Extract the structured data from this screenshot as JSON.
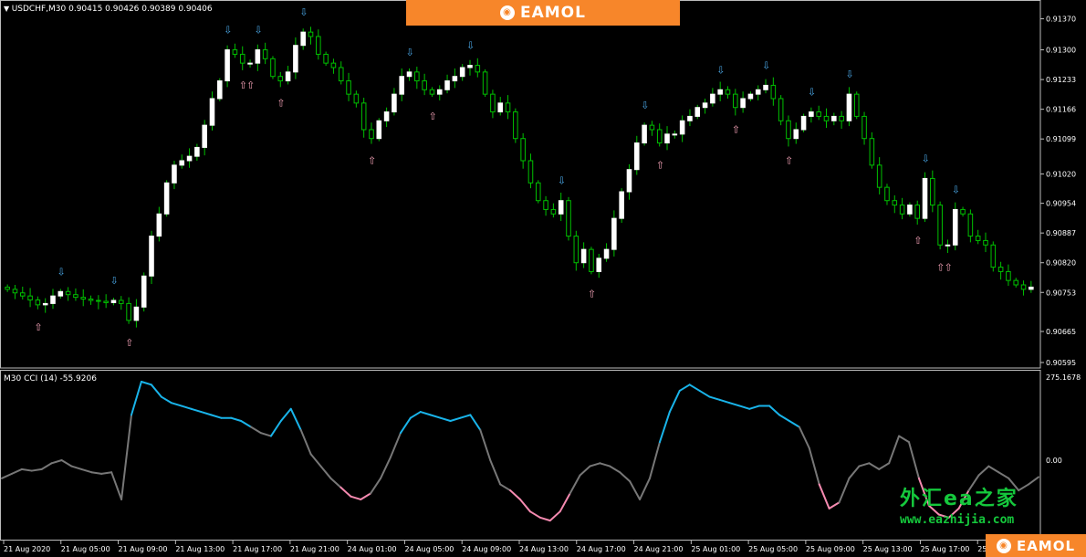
{
  "header": {
    "symbol_line": "USDCHF,M30  0.90415 0.90426 0.90389 0.90406",
    "cci_line": "M30 CCI (14) -55.9206"
  },
  "branding": {
    "name": "EAMOL",
    "watermark_cn": "外汇ea之家",
    "watermark_url": "www.eazhijia.com"
  },
  "colors": {
    "bull_candle": "#ffffff",
    "wick": "#00c000",
    "cci_mid": "#777777",
    "cci_high": "#19b4ea",
    "cci_low": "#f58ab0",
    "arrow_up": "#f6a3b8",
    "arrow_down": "#4aa8e8",
    "brand_bg": "#f7862a",
    "grid_line": "#ffffff"
  },
  "chart_data": [
    {
      "type": "candlestick",
      "title": "USDCHF,M30",
      "ohlc_header": {
        "open": 0.90415,
        "high": 0.90426,
        "low": 0.90389,
        "close": 0.90406
      },
      "ylim": [
        0.90595,
        0.914
      ],
      "y_tick_labels": [
        "0.91370",
        "0.91300",
        "0.91233",
        "0.91166",
        "0.91099",
        "0.91020",
        "0.90954",
        "0.90887",
        "0.90820",
        "0.90753",
        "0.90665",
        "0.90595"
      ],
      "y_ticks": [
        0.9137,
        0.913,
        0.91233,
        0.91166,
        0.91099,
        0.9102,
        0.90954,
        0.90887,
        0.9082,
        0.90753,
        0.90665,
        0.90595
      ],
      "x_tick_labels": [
        "21 Aug 2020",
        "21 Aug 05:00",
        "21 Aug 09:00",
        "21 Aug 13:00",
        "21 Aug 17:00",
        "21 Aug 21:00",
        "24 Aug 01:00",
        "24 Aug 05:00",
        "24 Aug 09:00",
        "24 Aug 13:00",
        "24 Aug 17:00",
        "24 Aug 21:00",
        "25 Aug 01:00",
        "25 Aug 05:00",
        "25 Aug 09:00",
        "25 Aug 13:00",
        "25 Aug 17:00",
        "25 Aug 21:00"
      ],
      "close_path": [
        0.9076,
        0.90752,
        0.90745,
        0.90736,
        0.90725,
        0.90728,
        0.90745,
        0.90755,
        0.90748,
        0.90742,
        0.90738,
        0.90735,
        0.90733,
        0.9073,
        0.90735,
        0.90728,
        0.9069,
        0.9072,
        0.9079,
        0.9088,
        0.9093,
        0.91,
        0.9104,
        0.9105,
        0.9106,
        0.9108,
        0.9113,
        0.9119,
        0.9123,
        0.913,
        0.9129,
        0.9127,
        0.9127,
        0.913,
        0.9128,
        0.9124,
        0.9123,
        0.9125,
        0.9131,
        0.9134,
        0.9133,
        0.9129,
        0.9127,
        0.9126,
        0.9123,
        0.912,
        0.9118,
        0.9112,
        0.911,
        0.9114,
        0.9116,
        0.912,
        0.9124,
        0.9125,
        0.9123,
        0.9121,
        0.912,
        0.9121,
        0.9123,
        0.9124,
        0.9126,
        0.91265,
        0.9125,
        0.912,
        0.9116,
        0.9118,
        0.9116,
        0.911,
        0.9105,
        0.91,
        0.9096,
        0.9094,
        0.9093,
        0.9096,
        0.9088,
        0.9082,
        0.9085,
        0.908,
        0.9083,
        0.9085,
        0.9092,
        0.9098,
        0.9103,
        0.9109,
        0.9113,
        0.9112,
        0.9109,
        0.9111,
        0.9111,
        0.9114,
        0.9115,
        0.9117,
        0.9118,
        0.912,
        0.9121,
        0.912,
        0.9117,
        0.9119,
        0.912,
        0.9121,
        0.9122,
        0.9119,
        0.9114,
        0.911,
        0.9112,
        0.9115,
        0.9116,
        0.9115,
        0.9114,
        0.9115,
        0.9114,
        0.912,
        0.9115,
        0.911,
        0.9104,
        0.9099,
        0.9096,
        0.9095,
        0.9093,
        0.9095,
        0.9092,
        0.9101,
        0.9095,
        0.9086,
        0.9086,
        0.9094,
        0.9093,
        0.9088,
        0.9087,
        0.9086,
        0.9081,
        0.908,
        0.9078,
        0.9077,
        0.9076,
        0.90765
      ]
    },
    {
      "type": "line",
      "title": "M30 CCI (14)",
      "current_value": -55.9206,
      "ylim": [
        -242.0,
        275.1678
      ],
      "y_tick_labels": [
        "275.1678",
        "0.00"
      ],
      "levels": {
        "high": 100,
        "low": -100
      },
      "values": [
        -60,
        -45,
        -30,
        -35,
        -30,
        -10,
        0,
        -20,
        -30,
        -40,
        -45,
        -40,
        -130,
        150,
        260,
        250,
        210,
        190,
        180,
        170,
        160,
        150,
        140,
        140,
        130,
        110,
        90,
        80,
        130,
        170,
        100,
        20,
        -20,
        -60,
        -90,
        -120,
        -130,
        -110,
        -60,
        10,
        90,
        140,
        160,
        150,
        140,
        130,
        140,
        150,
        100,
        0,
        -80,
        -100,
        -130,
        -170,
        -190,
        -200,
        -170,
        -110,
        -50,
        -20,
        -10,
        -20,
        -40,
        -70,
        -130,
        -60,
        60,
        160,
        230,
        250,
        230,
        210,
        200,
        190,
        180,
        170,
        180,
        180,
        150,
        130,
        110,
        40,
        -80,
        -160,
        -140,
        -60,
        -20,
        -10,
        -30,
        -10,
        80,
        60,
        -60,
        -150,
        -180,
        -190,
        -160,
        -100,
        -50,
        -20,
        -40,
        -60,
        -100,
        -80,
        -55.9206
      ]
    }
  ]
}
